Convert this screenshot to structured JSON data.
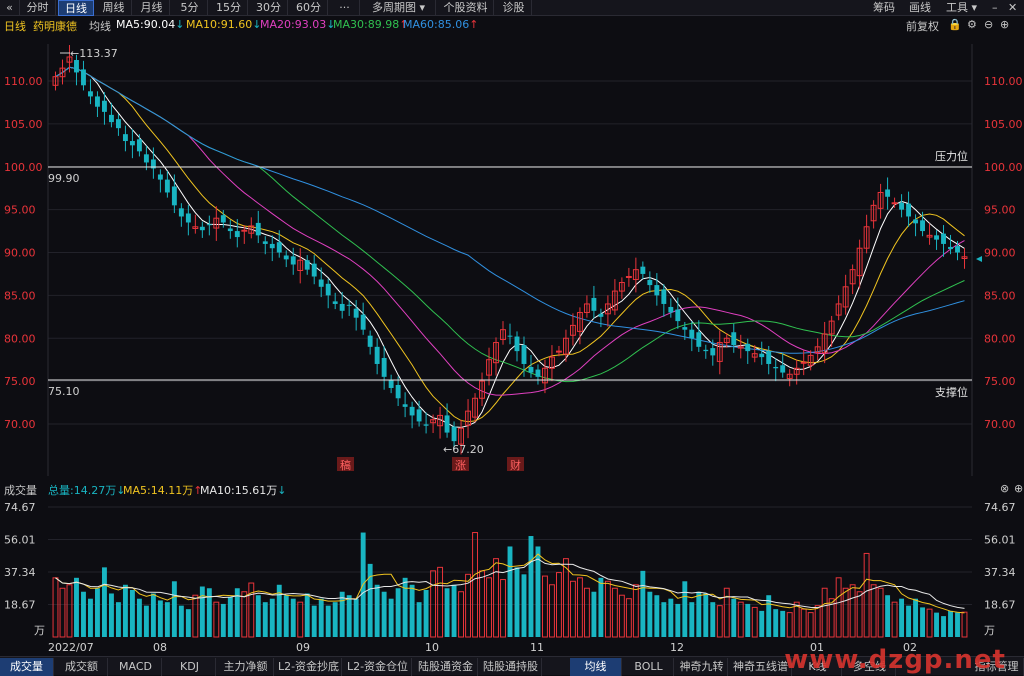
{
  "toolbar": {
    "back_icon": "«",
    "periods": [
      "分时",
      "日线",
      "周线",
      "月线",
      "5分",
      "15分",
      "30分",
      "60分",
      "···",
      "多周期图 ▾",
      "个股资料",
      "诊股"
    ],
    "active_period": "日线",
    "right_items": [
      "筹码",
      "画线",
      "工具 ▾"
    ],
    "window_controls": [
      "–",
      "✕"
    ]
  },
  "info": {
    "period": "日线",
    "stock_name": "药明康德",
    "ma_label": "均线",
    "ma5": "MA5:90.04",
    "ma10": "MA10:91.60",
    "ma20": "MA20:93.03",
    "ma30": "MA30:89.98",
    "ma60": "MA60:85.06",
    "adjust": "前复权",
    "colors": {
      "ma5": "#ffffff",
      "ma10": "#f0c420",
      "ma20": "#e040c0",
      "ma30": "#30c050",
      "ma60": "#3090e0",
      "up": "#e8343a",
      "down": "#19b5c2"
    }
  },
  "volume_info": {
    "label": "成交量",
    "total": "总量:14.27万",
    "ma5": "MA5:14.11万",
    "ma10": "MA10:15.61万"
  },
  "bottom_tabs": [
    "成交量",
    "成交额",
    "MACD",
    "KDJ",
    "主力净额",
    "L2-资金抄底",
    "L2-资金仓位",
    "陆股通资金",
    "陆股通持股",
    "均线",
    "BOLL",
    "神奇九转",
    "神奇五线谱",
    "K线",
    "多空线",
    "指标管理"
  ],
  "active_bottom_tab": "成交量",
  "watermark": "www.dzgp.net",
  "chart_data": [
    {
      "type": "candlestick",
      "title": "药明康德 日线",
      "ylim": [
        66,
        115
      ],
      "y_ticks": [
        "110.00",
        "105.00",
        "100.00",
        "95.00",
        "90.00",
        "85.00",
        "80.00",
        "75.00",
        "70.00"
      ],
      "x_labels": [
        "2022/07",
        "08",
        "09",
        "10",
        "11",
        "12",
        "01",
        "02"
      ],
      "annotations": {
        "high": "113.37",
        "low": "67.20",
        "resistance_value": "99.90",
        "resistance_label": "压力位",
        "support_value": "75.10",
        "support_label": "支撑位"
      },
      "event_marks": [
        "稿",
        "涨",
        "财"
      ],
      "close_series": [
        110.5,
        111.5,
        112.8,
        111.0,
        109.5,
        108.2,
        107.0,
        106.4,
        105.2,
        104.5,
        103.0,
        102.5,
        101.8,
        100.5,
        99.8,
        98.5,
        97.0,
        95.5,
        94.2,
        93.5,
        93.0,
        92.6,
        93.2,
        94.0,
        93.5,
        92.5,
        91.8,
        92.6,
        93.1,
        92.0,
        91.0,
        90.5,
        90.0,
        89.2,
        88.6,
        89.1,
        88.0,
        87.2,
        86.0,
        85.0,
        84.0,
        83.2,
        83.8,
        82.4,
        81.0,
        79.0,
        77.0,
        75.5,
        74.2,
        73.0,
        72.0,
        71.0,
        70.3,
        69.8,
        70.5,
        71.0,
        69.0,
        68.0,
        69.5,
        71.5,
        73.0,
        75.0,
        77.5,
        79.5,
        81.0,
        80.2,
        78.5,
        77.0,
        76.0,
        75.5,
        76.5,
        77.8,
        78.5,
        80.0,
        81.5,
        83.0,
        84.0,
        83.2,
        82.5,
        84.0,
        85.5,
        86.5,
        87.2,
        88.0,
        87.5,
        86.2,
        85.0,
        84.0,
        83.0,
        82.0,
        81.0,
        80.0,
        79.0,
        78.5,
        78.0,
        79.5,
        80.0,
        79.2,
        79.0,
        78.5,
        78.2,
        77.8,
        77.0,
        76.5,
        76.0,
        75.8,
        76.5,
        77.2,
        78.0,
        79.0,
        80.5,
        82.0,
        84.0,
        86.0,
        88.0,
        90.5,
        93.0,
        95.5,
        97.0,
        96.5,
        95.8,
        95.0,
        94.2,
        93.4,
        92.5,
        92.0,
        91.5,
        91.0,
        90.4,
        90.0,
        89.5
      ],
      "volume": {
        "ylim": [
          0,
          80
        ],
        "y_ticks": [
          "74.67",
          "56.01",
          "37.34",
          "18.67"
        ],
        "unit": "万",
        "series": [
          34,
          28,
          30,
          34,
          26,
          22,
          28,
          40,
          25,
          20,
          30,
          27,
          22,
          18,
          25,
          21,
          20,
          32,
          18,
          16,
          24,
          29,
          28,
          20,
          19,
          23,
          28,
          26,
          31,
          24,
          20,
          22,
          30,
          24,
          22,
          20,
          25,
          18,
          22,
          18,
          20,
          26,
          24,
          22,
          60,
          42,
          30,
          26,
          22,
          28,
          34,
          30,
          20,
          27,
          38,
          40,
          28,
          30,
          26,
          36,
          60,
          38,
          34,
          45,
          33,
          52,
          40,
          36,
          58,
          52,
          35,
          30,
          37,
          45,
          32,
          34,
          28,
          26,
          34,
          32,
          28,
          24,
          22,
          30,
          38,
          26,
          24,
          20,
          22,
          19,
          32,
          20,
          26,
          25,
          20,
          18,
          28,
          22,
          20,
          19,
          17,
          15,
          24,
          16,
          15,
          14,
          20,
          16,
          14,
          18,
          28,
          22,
          34,
          28,
          30,
          26,
          48,
          30,
          28,
          24,
          20,
          22,
          18,
          22,
          17,
          16,
          14,
          12,
          15,
          14,
          14.27
        ]
      }
    }
  ]
}
